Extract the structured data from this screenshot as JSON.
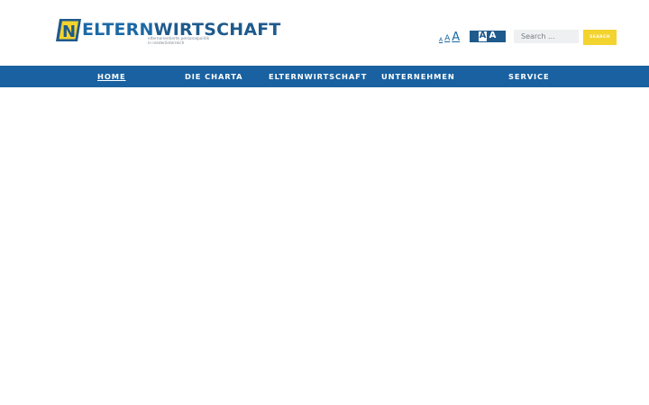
{
  "header": {
    "logo": {
      "word_part1": "ELTERN",
      "word_part2": "WIRTSCHAFT",
      "mark_letter": "N",
      "tagline_line1": "elternorientierte personalpolitik",
      "tagline_line2": "in niederösterreich"
    },
    "font_size_switch": {
      "small": "A",
      "medium": "A",
      "large": "A"
    },
    "contrast_switch": {
      "inverted": "A",
      "normal": "A"
    },
    "search": {
      "placeholder": "Search ...",
      "button_label": "SEARCH"
    }
  },
  "navigation": {
    "items": [
      {
        "label": "HOME",
        "active": true
      },
      {
        "label": "DIE CHARTA",
        "active": false
      },
      {
        "label": "ELTERNWIRTSCHAFT",
        "active": false
      },
      {
        "label": "UNTERNEHMEN",
        "active": false
      },
      {
        "label": "SERVICE",
        "active": false
      }
    ]
  },
  "colors": {
    "brand_blue": "#1961a0",
    "brand_dark_blue": "#1f5a8c",
    "brand_yellow": "#f3d32e",
    "background": "#ffffff"
  }
}
